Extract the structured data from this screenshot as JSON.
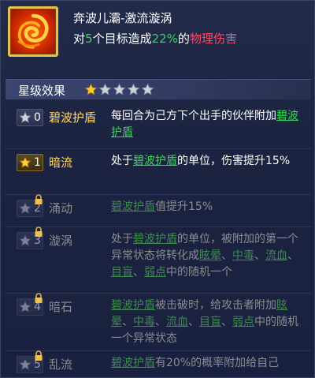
{
  "skill": {
    "name": "奔波儿灞-激流漩涡",
    "desc_prefix": "对",
    "target_count": "5",
    "desc_mid": "个目标造成",
    "percent": "22%",
    "desc_of": "的",
    "damage_type": "物理伤害",
    "icon": "vortex-icon"
  },
  "star_bar": {
    "title": "星级效果",
    "stars_filled": 1,
    "stars_total": 5
  },
  "colors": {
    "green": "#37d65a",
    "red": "#ff4a6a",
    "gold": "#ffd766",
    "grey": "#8b8c8f"
  },
  "rows": [
    {
      "level": "0",
      "name": "碧波护盾",
      "state": "on",
      "text": [
        {
          "t": "每回合为己方下个出手的伙伴附加"
        },
        {
          "t": "碧波护盾",
          "kw": true
        }
      ]
    },
    {
      "level": "1",
      "name": "暗流",
      "state": "on",
      "text": [
        {
          "t": "处于"
        },
        {
          "t": "碧波护盾",
          "kw": true
        },
        {
          "t": "的单位，伤害提升15%"
        }
      ]
    },
    {
      "level": "2",
      "name": "涌动",
      "state": "locked",
      "text": [
        {
          "t": "碧波护盾",
          "kw": true
        },
        {
          "t": "值提升15%"
        }
      ]
    },
    {
      "level": "3",
      "name": "漩涡",
      "state": "locked",
      "text": [
        {
          "t": "处于"
        },
        {
          "t": "碧波护盾",
          "kw": true
        },
        {
          "t": "的单位，被附加的第一个异常状态将转化成"
        },
        {
          "t": "眩晕",
          "kw": true
        },
        {
          "t": "、"
        },
        {
          "t": "中毒",
          "kw": true
        },
        {
          "t": "、"
        },
        {
          "t": "流血",
          "kw": true
        },
        {
          "t": "、"
        },
        {
          "t": "目盲",
          "kw": true
        },
        {
          "t": "、"
        },
        {
          "t": "弱点",
          "kw": true
        },
        {
          "t": "中的随机一个"
        }
      ]
    },
    {
      "level": "4",
      "name": "暗石",
      "state": "locked",
      "text": [
        {
          "t": "碧波护盾",
          "kw": true
        },
        {
          "t": "被击破时，给攻击者附加"
        },
        {
          "t": "眩晕",
          "kw": true
        },
        {
          "t": "、"
        },
        {
          "t": "中毒",
          "kw": true
        },
        {
          "t": "、"
        },
        {
          "t": "流血",
          "kw": true
        },
        {
          "t": "、"
        },
        {
          "t": "目盲",
          "kw": true
        },
        {
          "t": "、"
        },
        {
          "t": "弱点",
          "kw": true
        },
        {
          "t": "中的随机一个异常状态"
        }
      ]
    },
    {
      "level": "5",
      "name": "乱流",
      "state": "locked",
      "text": [
        {
          "t": "碧波护盾",
          "kw": true
        },
        {
          "t": "有20%的概率附加给自己"
        }
      ]
    }
  ]
}
